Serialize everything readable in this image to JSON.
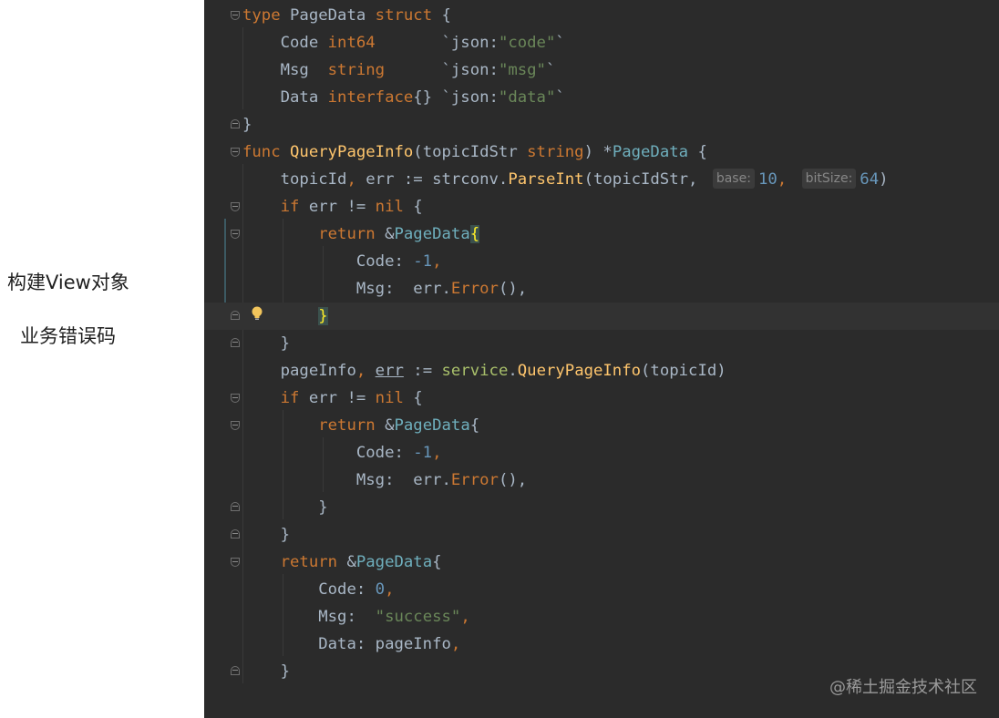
{
  "annotations": {
    "note1": "构建View对象",
    "note2": "业务错误码"
  },
  "watermark": "@稀土掘金技术社区",
  "hints": {
    "base_label": "base:",
    "bitsize_label": "bitSize:"
  },
  "code": {
    "l1": {
      "a": "type",
      "b": " PageData ",
      "c": "struct",
      "d": " {"
    },
    "l2": {
      "a": "    Code ",
      "b": "int64",
      "c": "       `json:",
      "d": "\"code\"",
      "e": "`"
    },
    "l3": {
      "a": "    Msg  ",
      "b": "string",
      "c": "      `json:",
      "d": "\"msg\"",
      "e": "`"
    },
    "l4": {
      "a": "    Data ",
      "b": "interface",
      "c": "{} `json:",
      "d": "\"data\"",
      "e": "`"
    },
    "l5": {
      "a": "}"
    },
    "l6": {
      "a": "func ",
      "b": "QueryPageInfo",
      "c": "(topicIdStr ",
      "d": "string",
      "e": ") *",
      "f": "PageData",
      "g": " {"
    },
    "l7": {
      "a": "    topicId",
      "b": ", ",
      "c": "err := strconv.",
      "d": "ParseInt",
      "e": "(topicIdStr, ",
      "f": "10",
      "g": ", ",
      "h": "64",
      "i": ")"
    },
    "l8": {
      "a": "    ",
      "b": "if",
      "c": " err != ",
      "d": "nil",
      "e": " {"
    },
    "l9": {
      "a": "        ",
      "b": "return",
      "c": " &",
      "d": "PageData",
      "e": "{"
    },
    "l10": {
      "a": "            Code: ",
      "b": "-1",
      "c": ","
    },
    "l11": {
      "a": "            Msg:  err.",
      "b": "Error",
      "c": "(),"
    },
    "l12": {
      "a": "        ",
      "b": "}"
    },
    "l13": {
      "a": "    }"
    },
    "l14": {
      "a": "    pageInfo",
      ",": ", ",
      "b": "err",
      "c": " := ",
      "d": "service",
      "e": ".",
      "f": "QueryPageInfo",
      "g": "(topicId)"
    },
    "l15": {
      "a": "    ",
      "b": "if",
      "c": " err != ",
      "d": "nil",
      "e": " {"
    },
    "l16": {
      "a": "        ",
      "b": "return",
      "c": " &",
      "d": "PageData",
      "e": "{"
    },
    "l17": {
      "a": "            Code: ",
      "b": "-1",
      "c": ","
    },
    "l18": {
      "a": "            Msg:  err.",
      "b": "Error",
      "c": "(),"
    },
    "l19": {
      "a": "        }"
    },
    "l20": {
      "a": "    }"
    },
    "l21": {
      "a": "    ",
      "b": "return",
      "c": " &",
      "d": "PageData",
      "e": "{"
    },
    "l22": {
      "a": "        Code: ",
      "b": "0",
      "c": ","
    },
    "l23": {
      "a": "        Msg:  ",
      "b": "\"success\"",
      "c": ","
    },
    "l24": {
      "a": "        Data: pageInfo",
      "b": ","
    },
    "l25": {
      "a": "    }"
    }
  },
  "colors": {
    "keyword": "#cc7832",
    "function": "#ffc66d",
    "type": "#6fafbd",
    "string": "#6a8759",
    "number": "#6897bb",
    "text": "#a9b7c6"
  }
}
